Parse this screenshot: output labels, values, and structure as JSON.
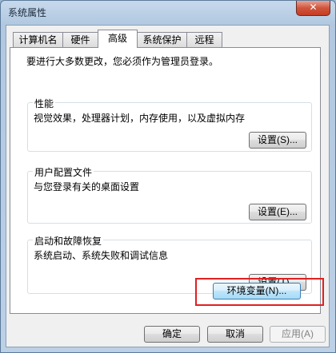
{
  "window": {
    "title": "系统属性",
    "close_glyph": "✕"
  },
  "tabs": [
    {
      "label": "计算机名"
    },
    {
      "label": "硬件"
    },
    {
      "label": "高级"
    },
    {
      "label": "系统保护"
    },
    {
      "label": "远程"
    }
  ],
  "active_tab": "高级",
  "advanced": {
    "notice": "要进行大多数更改，您必须作为管理员登录。",
    "performance": {
      "title": "性能",
      "description": "视觉效果，处理器计划，内存使用，以及虚拟内存",
      "button": "设置(S)..."
    },
    "user_profiles": {
      "title": "用户配置文件",
      "description": "与您登录有关的桌面设置",
      "button": "设置(E)..."
    },
    "startup_recovery": {
      "title": "启动和故障恢复",
      "description": "系统启动、系统失败和调试信息",
      "button": "设置(T)..."
    },
    "env_button": "环境变量(N)..."
  },
  "footer": {
    "ok": "确定",
    "cancel": "取消",
    "apply": "应用(A)"
  },
  "colors": {
    "highlight_border": "#e02020",
    "close_button": "#c53b22"
  }
}
